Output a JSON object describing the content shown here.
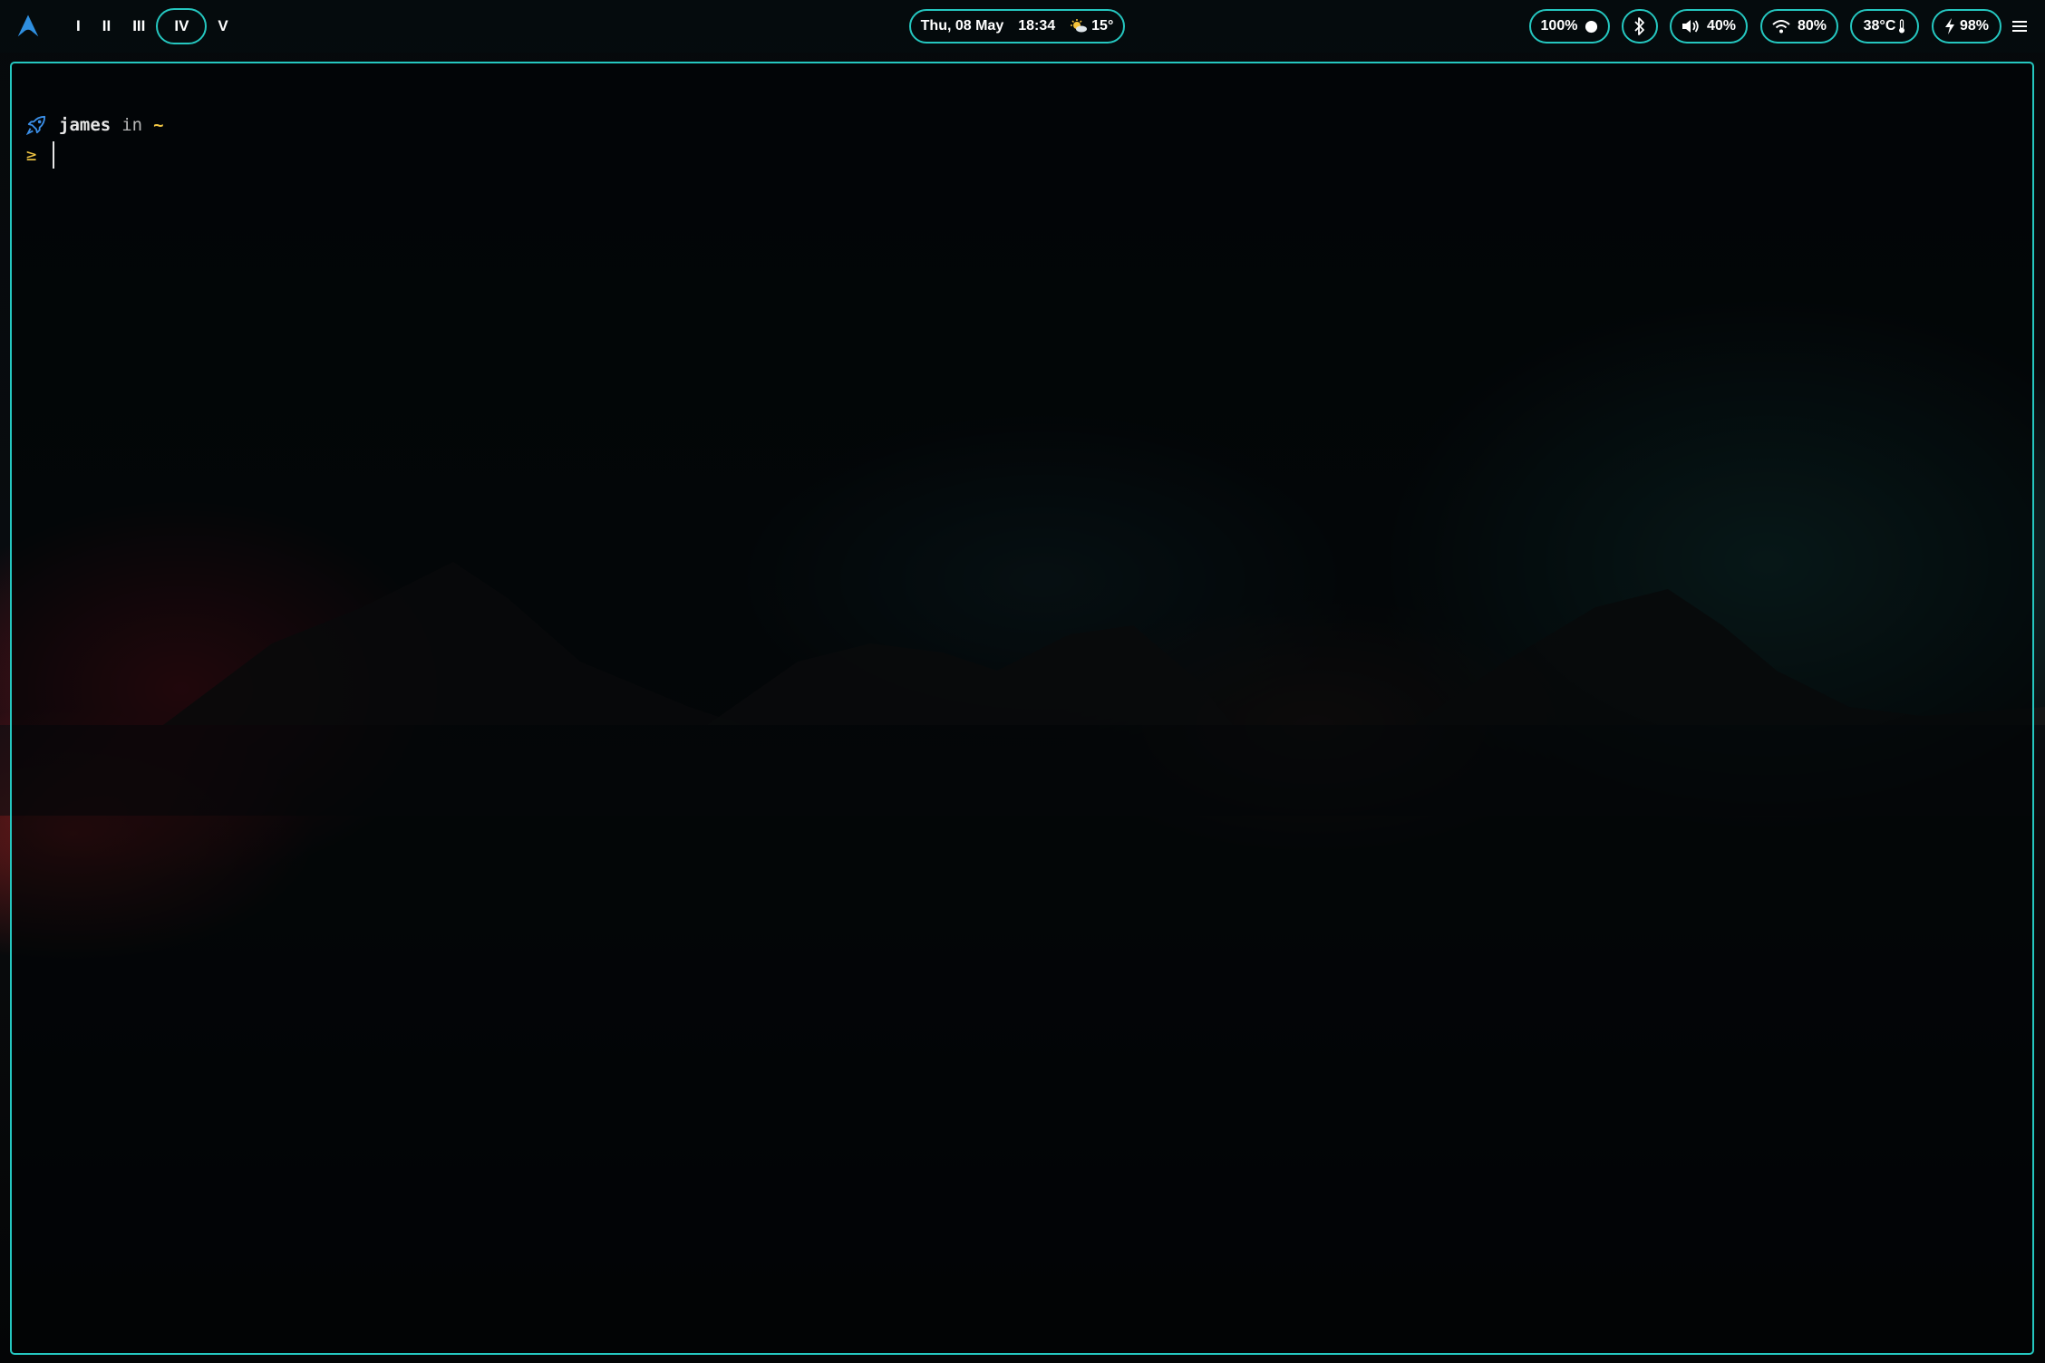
{
  "taskbar": {
    "logo_icon": "arch-linux-icon",
    "workspaces": [
      {
        "label": "I",
        "active": false
      },
      {
        "label": "II",
        "active": false
      },
      {
        "label": "III",
        "active": false
      },
      {
        "label": "IV",
        "active": true
      },
      {
        "label": "V",
        "active": false
      }
    ],
    "clock": {
      "date": "Thu, 08 May",
      "time": "18:34",
      "weather_icon": "sun-cloud-icon",
      "temperature": "15°"
    },
    "brightness": {
      "value": "100%",
      "icon": "brightness-dot-icon"
    },
    "bluetooth": {
      "icon": "bluetooth-icon"
    },
    "volume": {
      "value": "40%",
      "icon": "volume-icon"
    },
    "wifi": {
      "value": "80%",
      "icon": "wifi-icon"
    },
    "cpu_temp": {
      "value": "38°C",
      "icon": "thermometer-icon"
    },
    "battery": {
      "value": "98%",
      "icon": "charging-bolt-icon"
    },
    "menu_icon": "hamburger-menu-icon"
  },
  "terminal": {
    "prompt_icon": "rocket-icon",
    "user": "james",
    "in_word": "in",
    "directory": "~",
    "prompt_symbol": "≥",
    "input_value": ""
  },
  "colors": {
    "accent": "#25c7c0",
    "prompt_yellow": "#f2c744",
    "rocket_blue": "#3a8ee6"
  }
}
